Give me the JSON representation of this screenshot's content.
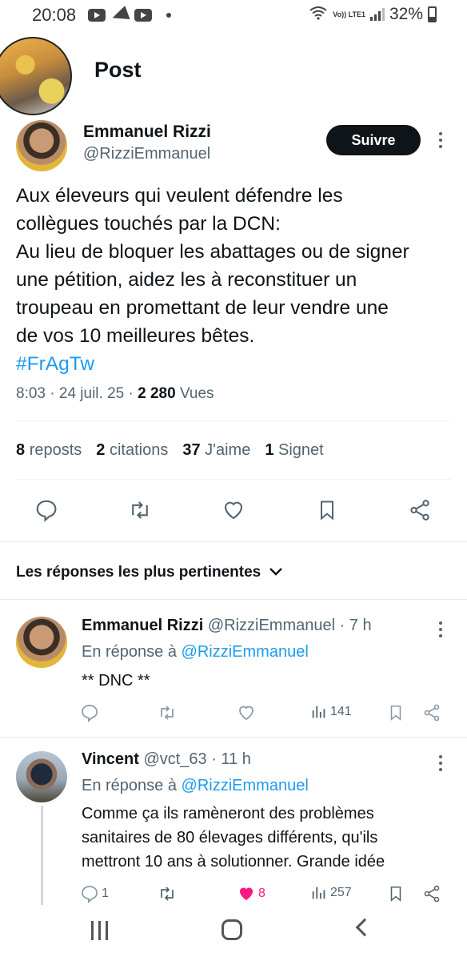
{
  "status_bar": {
    "time": "20:08",
    "network": "Vo)) LTE1",
    "battery": "32%"
  },
  "header": {
    "title": "Post"
  },
  "post": {
    "author_name": "Emmanuel Rizzi",
    "author_handle": "@RizziEmmanuel",
    "follow_label": "Suivre",
    "text_lines": [
      "Aux éleveurs qui veulent défendre les",
      "collègues touchés par la DCN:",
      "Au lieu de bloquer les abattages ou de signer",
      "une pétition, aidez les à reconstituer un",
      "troupeau en promettant de leur vendre une",
      "de vos 10 meilleures bêtes."
    ],
    "hashtag": "#FrAgTw",
    "time": "8:03",
    "date": "24 juil. 25",
    "views_count": "2 280",
    "views_label": "Vues"
  },
  "stats": {
    "reposts_count": "8",
    "reposts_label": "reposts",
    "citations_count": "2",
    "citations_label": "citations",
    "likes_count": "37",
    "likes_label": "J'aime",
    "bookmarks_count": "1",
    "bookmarks_label": "Signet"
  },
  "actions": [
    "reply-icon",
    "repost-icon",
    "like-icon",
    "bookmark-icon",
    "share-icon"
  ],
  "replies_sort": {
    "label": "Les réponses les plus pertinentes"
  },
  "replies": [
    {
      "name": "Emmanuel Rizzi",
      "handle_time": "@RizziEmmanuel · 7 h",
      "in_reply_prefix": "En réponse à",
      "in_reply_mention": "@RizziEmmanuel",
      "text_lines": [
        "** DNC **"
      ],
      "views": "141"
    },
    {
      "name": "Vincent",
      "handle_time": "@vct_63 · 11 h",
      "in_reply_prefix": "En réponse à",
      "in_reply_mention": "@RizziEmmanuel",
      "text_lines": [
        "Comme ça ils ramèneront des problèmes",
        "sanitaires de 80 élevages différents, qu'ils",
        "mettront 10 ans à solutionner. Grande idée"
      ],
      "replies": "1",
      "likes": "8",
      "views": "257"
    }
  ],
  "colors": {
    "accent": "#1d9bf0",
    "like_active": "#f91880",
    "text_primary": "#0f1419",
    "text_secondary": "#536471"
  }
}
